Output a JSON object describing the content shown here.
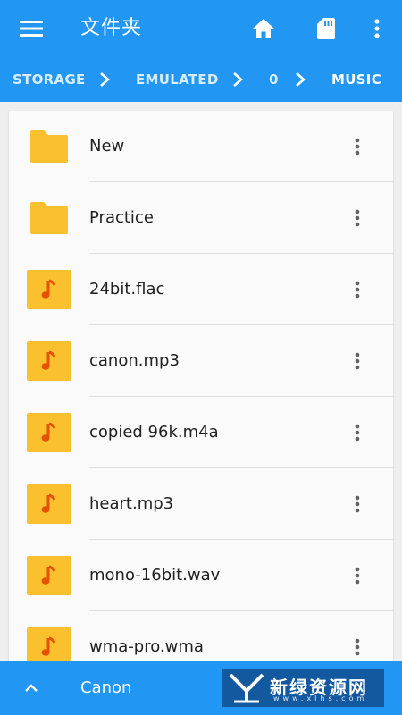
{
  "app": {
    "title": "文件夹"
  },
  "toolbar": {
    "menu_icon": "hamburger-menu-icon",
    "home_icon": "home-icon",
    "sd_icon": "sd-card-icon",
    "more_icon": "more-vert-icon"
  },
  "breadcrumb": [
    "STORAGE",
    "EMULATED",
    "0",
    "MUSIC"
  ],
  "files": [
    {
      "name": "New",
      "type": "folder"
    },
    {
      "name": "Practice",
      "type": "folder"
    },
    {
      "name": "24bit.flac",
      "type": "audio"
    },
    {
      "name": "canon.mp3",
      "type": "audio"
    },
    {
      "name": "copied 96k.m4a",
      "type": "audio"
    },
    {
      "name": "heart.mp3",
      "type": "audio"
    },
    {
      "name": "mono-16bit.wav",
      "type": "audio"
    },
    {
      "name": "wma-pro.wma",
      "type": "audio"
    }
  ],
  "now_playing": {
    "title": "Canon",
    "expand_icon": "chevron-up-icon"
  },
  "watermark": {
    "text": "新绿资源网",
    "sub": "www.xlhs.com"
  },
  "colors": {
    "primary": "#2196f3",
    "folder": "#fbc02d",
    "audio_tile": "#fbc02d",
    "audio_note": "#e65100",
    "list_bg": "#fafafa",
    "page_bg": "#eeeeee"
  }
}
